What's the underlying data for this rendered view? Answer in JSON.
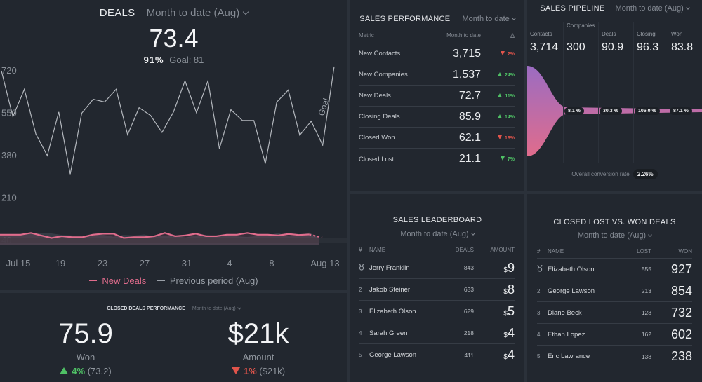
{
  "colors": {
    "panel_bg": "#22272f",
    "gap_bg": "#2b313a",
    "new_deals": "#e06c8c",
    "previous_period": "#9aa0a8",
    "up": "#4fc065",
    "down": "#e0544b",
    "funnel_top": "#9b6cc2",
    "funnel_bottom": "#e06c8c"
  },
  "deals": {
    "title": "DEALS",
    "period": "Month to date (Aug)",
    "value": "73.4",
    "goal_pct": "91%",
    "goal_label": "Goal: 81",
    "goal_annotation": "Goal",
    "legend": [
      {
        "name": "New Deals",
        "color": "#e06c8c"
      },
      {
        "name": "Previous period (Aug)",
        "color": "#9aa0a8"
      }
    ]
  },
  "chart_data": {
    "type": "line",
    "title": "DEALS",
    "xlabel": "",
    "ylabel": "",
    "ylim": [
      40,
      720
    ],
    "yticks": [
      "720",
      "550",
      "380",
      "210",
      "40"
    ],
    "xticks": [
      "Jul 15",
      "19",
      "23",
      "27",
      "31",
      "4",
      "8",
      "Aug 13"
    ],
    "grid": false,
    "legend_position": "bottom",
    "series": [
      {
        "name": "Goal",
        "values": [
          720,
          536,
          646,
          467,
          380,
          555,
          306,
          550,
          606,
          595,
          646,
          464,
          572,
          541,
          473,
          555,
          680,
          552,
          680,
          408,
          564,
          521,
          521,
          348,
          595,
          643,
          462,
          518,
          422,
          737
        ]
      },
      {
        "name": "New Deals",
        "values": [
          63,
          63,
          63,
          70,
          60,
          50,
          57,
          53,
          53,
          63,
          67,
          67,
          50,
          53,
          53,
          57,
          70,
          57,
          60,
          67,
          57,
          57,
          63,
          63,
          70,
          63,
          63,
          60,
          66,
          62,
          64,
          52
        ]
      },
      {
        "name": "Previous period (Aug)",
        "values": [
          58,
          60,
          62,
          68,
          70,
          68,
          62,
          60,
          56,
          62,
          63,
          55,
          62,
          60,
          64,
          55,
          60,
          58,
          52,
          60,
          62,
          57,
          63,
          56,
          54,
          58,
          60,
          70,
          56,
          58,
          72,
          50
        ]
      }
    ]
  },
  "closed_deals": {
    "title": "CLOSED DEALS PERFORMANCE",
    "period": "Month to date (Aug)",
    "won": {
      "value": "75.9",
      "label": "Won",
      "change": "4%",
      "previous": "(73.2)",
      "direction": "up"
    },
    "amount": {
      "value": "$21k",
      "label": "Amount",
      "change": "1%",
      "previous": "($21k)",
      "direction": "down"
    }
  },
  "sales_performance": {
    "title": "SALES PERFORMANCE",
    "period": "Month to date",
    "columns": [
      "Metric",
      "Month to date",
      "Δ"
    ],
    "rows": [
      {
        "metric": "New Contacts",
        "value": "3,715",
        "delta": "2%",
        "direction": "down",
        "good": false
      },
      {
        "metric": "New Companies",
        "value": "1,537",
        "delta": "24%",
        "direction": "up",
        "good": true
      },
      {
        "metric": "New Deals",
        "value": "72.7",
        "delta": "11%",
        "direction": "up",
        "good": true
      },
      {
        "metric": "Closing Deals",
        "value": "85.9",
        "delta": "14%",
        "direction": "up",
        "good": true
      },
      {
        "metric": "Closed Won",
        "value": "62.1",
        "delta": "16%",
        "direction": "down",
        "good": false
      },
      {
        "metric": "Closed Lost",
        "value": "21.1",
        "delta": "7%",
        "direction": "down",
        "good": true
      }
    ]
  },
  "sales_pipeline": {
    "title": "SALES PIPELINE",
    "period": "Month to date (Aug)",
    "stages": [
      {
        "label": "Contacts",
        "value": "3,714"
      },
      {
        "label": "Companies",
        "value": "300"
      },
      {
        "label": "Deals",
        "value": "90.9"
      },
      {
        "label": "Closing",
        "value": "96.3"
      },
      {
        "label": "Won",
        "value": "83.8"
      }
    ],
    "conversions": [
      "8.1 %",
      "30.3 %",
      "106.0 %",
      "87.1 %"
    ],
    "overall_label": "Overall conversion rate",
    "overall_value": "2.26%"
  },
  "sales_leaderboard": {
    "title": "SALES LEADERBOARD",
    "period": "Month to date (Aug)",
    "columns": [
      "#",
      "NAME",
      "DEALS",
      "AMOUNT"
    ],
    "rows": [
      {
        "rank": "1",
        "name": "Jerry Franklin",
        "deals": "843",
        "currency": "$",
        "amount": "9"
      },
      {
        "rank": "2",
        "name": "Jakob Steiner",
        "deals": "633",
        "currency": "$",
        "amount": "8"
      },
      {
        "rank": "3",
        "name": "Elizabeth Olson",
        "deals": "629",
        "currency": "$",
        "amount": "5"
      },
      {
        "rank": "4",
        "name": "Sarah Green",
        "deals": "218",
        "currency": "$",
        "amount": "4"
      },
      {
        "rank": "5",
        "name": "George Lawson",
        "deals": "411",
        "currency": "$",
        "amount": "4"
      }
    ]
  },
  "lost_won": {
    "title": "CLOSED LOST VS. WON DEALS",
    "period": "Month to date (Aug)",
    "columns": [
      "#",
      "NAME",
      "LOST",
      "WON"
    ],
    "rows": [
      {
        "rank": "1",
        "name": "Elizabeth Olson",
        "lost": "555",
        "won": "927"
      },
      {
        "rank": "2",
        "name": "George Lawson",
        "lost": "213",
        "won": "854"
      },
      {
        "rank": "3",
        "name": "Diane Beck",
        "lost": "128",
        "won": "732"
      },
      {
        "rank": "4",
        "name": "Ethan Lopez",
        "lost": "162",
        "won": "602"
      },
      {
        "rank": "5",
        "name": "Eric Lawrance",
        "lost": "138",
        "won": "238"
      }
    ]
  }
}
